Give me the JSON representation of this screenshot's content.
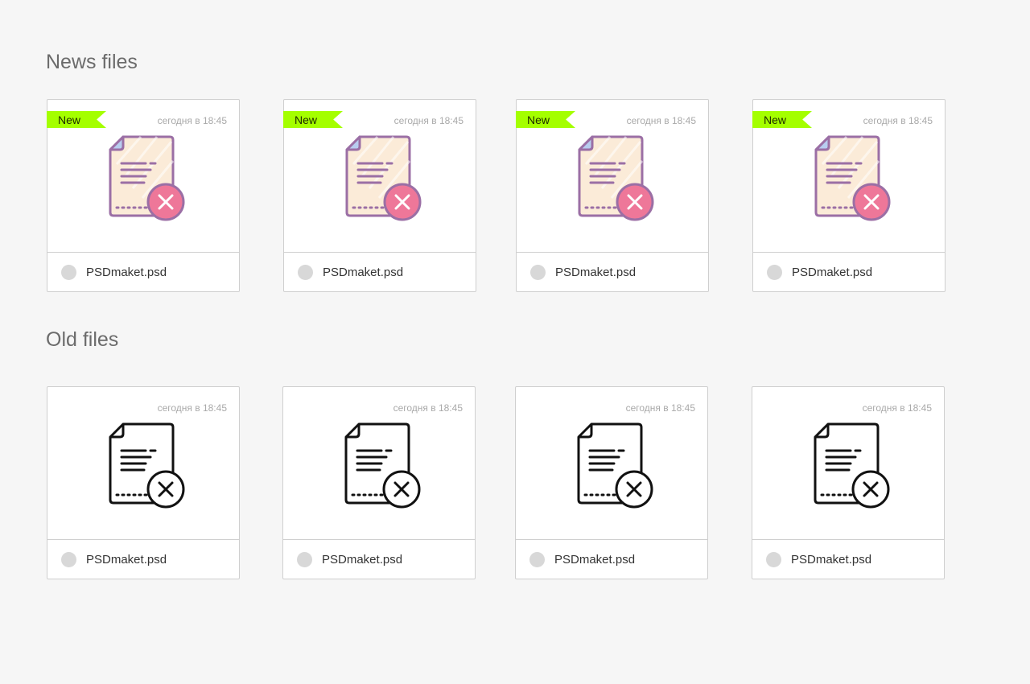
{
  "sections": [
    {
      "title": "News files",
      "cards": [
        {
          "badge": "New",
          "date": "сегодня в 18:45",
          "filename": "PSDmaket.psd",
          "icon": "file-error-color-icon"
        },
        {
          "badge": "New",
          "date": "сегодня в 18:45",
          "filename": "PSDmaket.psd",
          "icon": "file-error-color-icon"
        },
        {
          "badge": "New",
          "date": "сегодня в 18:45",
          "filename": "PSDmaket.psd",
          "icon": "file-error-color-icon"
        },
        {
          "badge": "New",
          "date": "сегодня в 18:45",
          "filename": "PSDmaket.psd",
          "icon": "file-error-color-icon"
        }
      ]
    },
    {
      "title": "Old files",
      "cards": [
        {
          "date": "сегодня в 18:45",
          "filename": "PSDmaket.psd",
          "icon": "file-error-outline-icon"
        },
        {
          "date": "сегодня в 18:45",
          "filename": "PSDmaket.psd",
          "icon": "file-error-outline-icon"
        },
        {
          "date": "сегодня в 18:45",
          "filename": "PSDmaket.psd",
          "icon": "file-error-outline-icon"
        },
        {
          "date": "сегодня в 18:45",
          "filename": "PSDmaket.psd",
          "icon": "file-error-outline-icon"
        }
      ]
    }
  ],
  "colors": {
    "background": "#f6f6f6",
    "new_badge": "#a4ff00",
    "icon_paper": "#fbebd8",
    "icon_stroke": "#9b6fa5",
    "icon_error": "#ee7799",
    "icon_corner": "#b8cdf0"
  }
}
